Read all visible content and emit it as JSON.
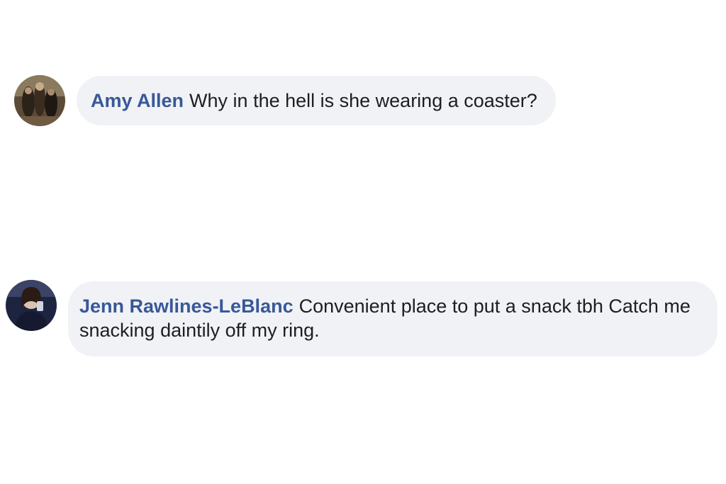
{
  "comments": [
    {
      "author": "Amy Allen",
      "text": "Why in the hell is she wearing a coaster?"
    },
    {
      "author": "Jenn Rawlines-LeBlanc",
      "text": "Convenient place to put a snack tbh Catch me snacking daintily off my ring."
    }
  ],
  "colors": {
    "author": "#385898",
    "bubble_bg": "#f1f2f6",
    "text": "#1c1e21"
  }
}
